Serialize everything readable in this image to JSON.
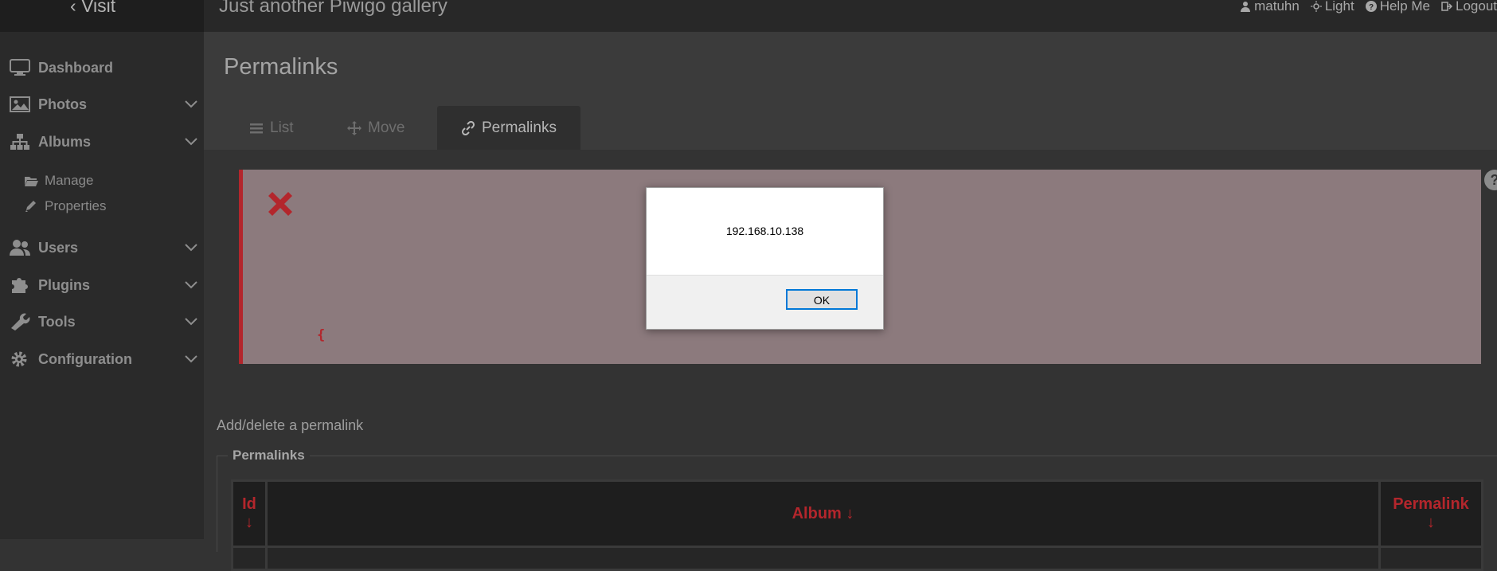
{
  "header": {
    "visit_label": "Visit",
    "gallery_title": "Just another Piwigo gallery",
    "user": "matuhn",
    "theme": "Light",
    "help": "Help Me",
    "logout": "Logout"
  },
  "sidebar": {
    "items": [
      {
        "label": "Dashboard",
        "icon": "monitor-icon"
      },
      {
        "label": "Photos",
        "icon": "image-icon"
      },
      {
        "label": "Albums",
        "icon": "sitemap-icon"
      },
      {
        "label": "Users",
        "icon": "users-icon"
      },
      {
        "label": "Plugins",
        "icon": "puzzle-icon"
      },
      {
        "label": "Tools",
        "icon": "wrench-icon"
      },
      {
        "label": "Configuration",
        "icon": "gear-icon"
      }
    ],
    "albums_sub": [
      {
        "label": "Manage",
        "icon": "folder-open-icon"
      },
      {
        "label": "Properties",
        "icon": "pencil-icon"
      }
    ]
  },
  "main": {
    "page_title": "Permalinks",
    "tabs": [
      {
        "label": "List",
        "icon": "list-icon"
      },
      {
        "label": "Move",
        "icon": "move-icon"
      },
      {
        "label": "Permalinks",
        "icon": "link-icon"
      }
    ],
    "error_brace": "{",
    "add_delete_label": "Add/delete a permalink",
    "fieldset_legend": "Permalinks",
    "table": {
      "col_id": "Id",
      "col_album": "Album",
      "col_permalink": "Permalink",
      "sort_arrow": "↓"
    }
  },
  "dialog": {
    "message": "192.168.10.138",
    "ok_label": "OK"
  },
  "colors": {
    "accent_red": "#b3262c",
    "error_bg": "#8c7a7d",
    "dialog_focus": "#0078d7"
  }
}
